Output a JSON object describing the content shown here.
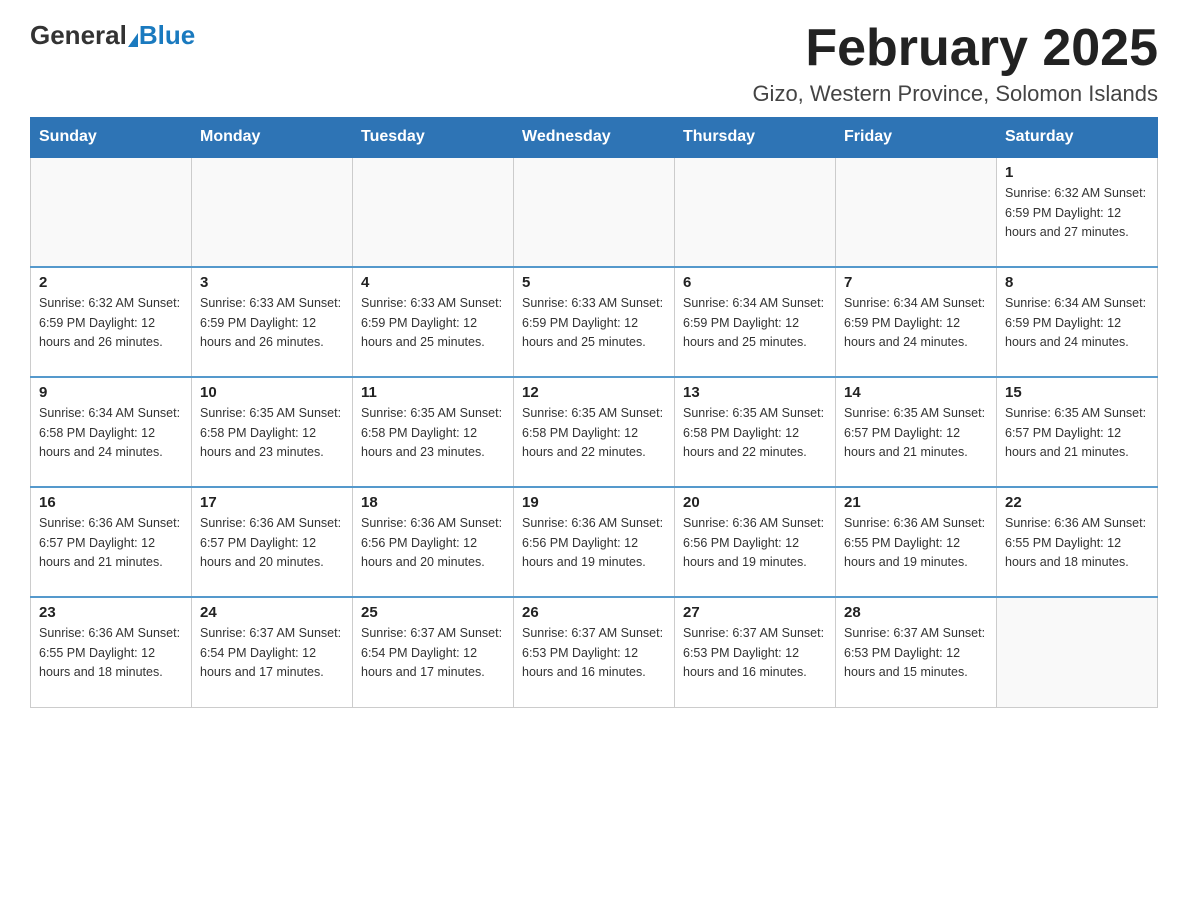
{
  "header": {
    "logo_general": "General",
    "logo_blue": "Blue",
    "month_title": "February 2025",
    "location": "Gizo, Western Province, Solomon Islands"
  },
  "days_of_week": [
    "Sunday",
    "Monday",
    "Tuesday",
    "Wednesday",
    "Thursday",
    "Friday",
    "Saturday"
  ],
  "weeks": [
    [
      {
        "day": "",
        "info": ""
      },
      {
        "day": "",
        "info": ""
      },
      {
        "day": "",
        "info": ""
      },
      {
        "day": "",
        "info": ""
      },
      {
        "day": "",
        "info": ""
      },
      {
        "day": "",
        "info": ""
      },
      {
        "day": "1",
        "info": "Sunrise: 6:32 AM\nSunset: 6:59 PM\nDaylight: 12 hours and 27 minutes."
      }
    ],
    [
      {
        "day": "2",
        "info": "Sunrise: 6:32 AM\nSunset: 6:59 PM\nDaylight: 12 hours and 26 minutes."
      },
      {
        "day": "3",
        "info": "Sunrise: 6:33 AM\nSunset: 6:59 PM\nDaylight: 12 hours and 26 minutes."
      },
      {
        "day": "4",
        "info": "Sunrise: 6:33 AM\nSunset: 6:59 PM\nDaylight: 12 hours and 25 minutes."
      },
      {
        "day": "5",
        "info": "Sunrise: 6:33 AM\nSunset: 6:59 PM\nDaylight: 12 hours and 25 minutes."
      },
      {
        "day": "6",
        "info": "Sunrise: 6:34 AM\nSunset: 6:59 PM\nDaylight: 12 hours and 25 minutes."
      },
      {
        "day": "7",
        "info": "Sunrise: 6:34 AM\nSunset: 6:59 PM\nDaylight: 12 hours and 24 minutes."
      },
      {
        "day": "8",
        "info": "Sunrise: 6:34 AM\nSunset: 6:59 PM\nDaylight: 12 hours and 24 minutes."
      }
    ],
    [
      {
        "day": "9",
        "info": "Sunrise: 6:34 AM\nSunset: 6:58 PM\nDaylight: 12 hours and 24 minutes."
      },
      {
        "day": "10",
        "info": "Sunrise: 6:35 AM\nSunset: 6:58 PM\nDaylight: 12 hours and 23 minutes."
      },
      {
        "day": "11",
        "info": "Sunrise: 6:35 AM\nSunset: 6:58 PM\nDaylight: 12 hours and 23 minutes."
      },
      {
        "day": "12",
        "info": "Sunrise: 6:35 AM\nSunset: 6:58 PM\nDaylight: 12 hours and 22 minutes."
      },
      {
        "day": "13",
        "info": "Sunrise: 6:35 AM\nSunset: 6:58 PM\nDaylight: 12 hours and 22 minutes."
      },
      {
        "day": "14",
        "info": "Sunrise: 6:35 AM\nSunset: 6:57 PM\nDaylight: 12 hours and 21 minutes."
      },
      {
        "day": "15",
        "info": "Sunrise: 6:35 AM\nSunset: 6:57 PM\nDaylight: 12 hours and 21 minutes."
      }
    ],
    [
      {
        "day": "16",
        "info": "Sunrise: 6:36 AM\nSunset: 6:57 PM\nDaylight: 12 hours and 21 minutes."
      },
      {
        "day": "17",
        "info": "Sunrise: 6:36 AM\nSunset: 6:57 PM\nDaylight: 12 hours and 20 minutes."
      },
      {
        "day": "18",
        "info": "Sunrise: 6:36 AM\nSunset: 6:56 PM\nDaylight: 12 hours and 20 minutes."
      },
      {
        "day": "19",
        "info": "Sunrise: 6:36 AM\nSunset: 6:56 PM\nDaylight: 12 hours and 19 minutes."
      },
      {
        "day": "20",
        "info": "Sunrise: 6:36 AM\nSunset: 6:56 PM\nDaylight: 12 hours and 19 minutes."
      },
      {
        "day": "21",
        "info": "Sunrise: 6:36 AM\nSunset: 6:55 PM\nDaylight: 12 hours and 19 minutes."
      },
      {
        "day": "22",
        "info": "Sunrise: 6:36 AM\nSunset: 6:55 PM\nDaylight: 12 hours and 18 minutes."
      }
    ],
    [
      {
        "day": "23",
        "info": "Sunrise: 6:36 AM\nSunset: 6:55 PM\nDaylight: 12 hours and 18 minutes."
      },
      {
        "day": "24",
        "info": "Sunrise: 6:37 AM\nSunset: 6:54 PM\nDaylight: 12 hours and 17 minutes."
      },
      {
        "day": "25",
        "info": "Sunrise: 6:37 AM\nSunset: 6:54 PM\nDaylight: 12 hours and 17 minutes."
      },
      {
        "day": "26",
        "info": "Sunrise: 6:37 AM\nSunset: 6:53 PM\nDaylight: 12 hours and 16 minutes."
      },
      {
        "day": "27",
        "info": "Sunrise: 6:37 AM\nSunset: 6:53 PM\nDaylight: 12 hours and 16 minutes."
      },
      {
        "day": "28",
        "info": "Sunrise: 6:37 AM\nSunset: 6:53 PM\nDaylight: 12 hours and 15 minutes."
      },
      {
        "day": "",
        "info": ""
      }
    ]
  ]
}
